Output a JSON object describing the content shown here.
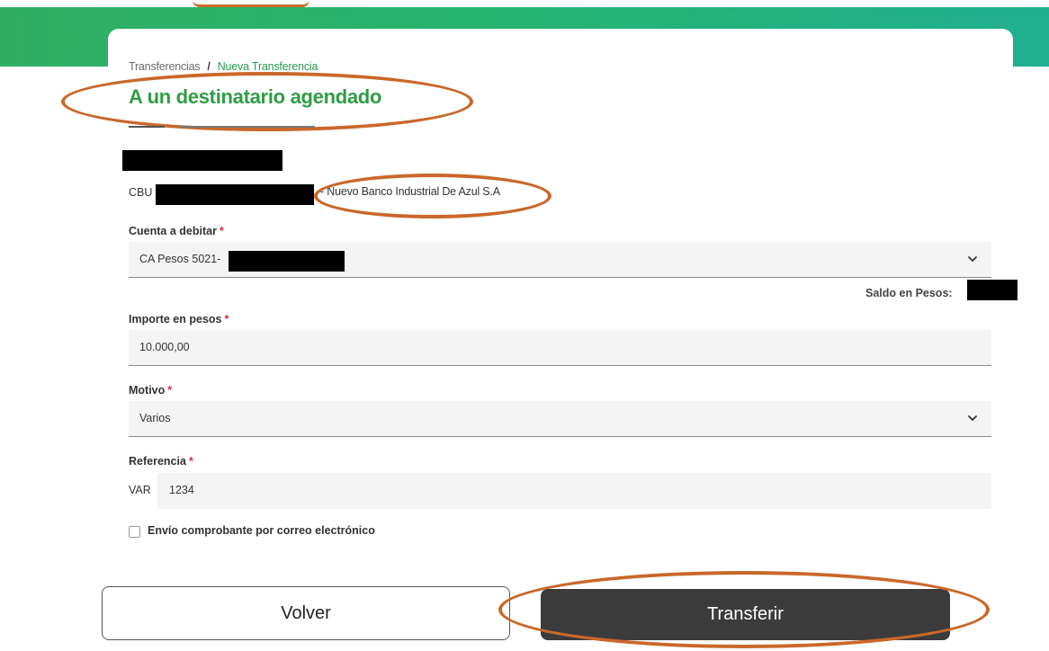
{
  "breadcrumb": {
    "parent": "Transferencias",
    "separator": "/",
    "current": "Nueva Transferencia"
  },
  "page_title": "A un destinatario agendado",
  "recipient": {
    "cbu_label": "CBU",
    "bank_name": "- Nuevo Banco Industrial De Azul S.A"
  },
  "debit_account": {
    "label": "Cuenta a debitar",
    "value": "CA Pesos 5021-",
    "balance_label": "Saldo en Pesos:"
  },
  "amount": {
    "label": "Importe en pesos",
    "value": "10.000,00"
  },
  "reason": {
    "label": "Motivo",
    "value": "Varios"
  },
  "reference": {
    "label": "Referencia",
    "prefix": "VAR",
    "value": "1234"
  },
  "email_receipt": {
    "label": "Envío comprobante por correo electrónico",
    "checked": false
  },
  "buttons": {
    "back": "Volver",
    "transfer": "Transferir"
  },
  "colors": {
    "brand_green": "#2e9d44",
    "required_red": "#e0283a",
    "annotation_orange": "#c9682a",
    "primary_button": "#3b3b3b"
  },
  "icons": {
    "dropdown": "chevron-down-icon"
  }
}
